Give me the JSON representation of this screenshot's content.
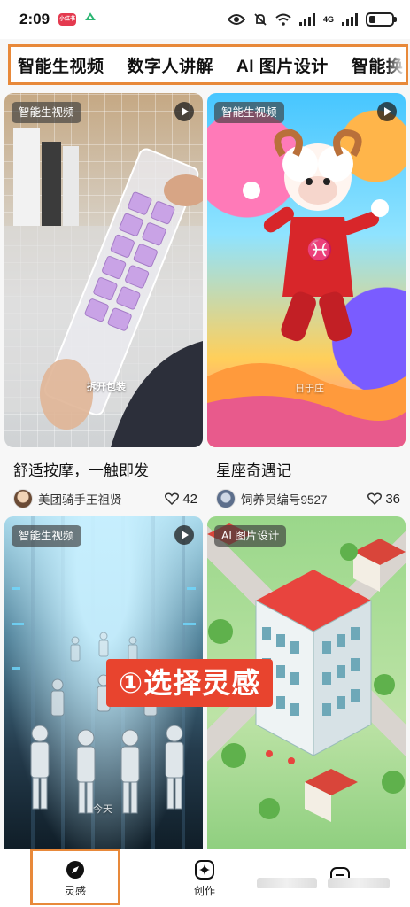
{
  "status_bar": {
    "time": "2:09",
    "app_badge": "小红书",
    "network": "4G"
  },
  "category_tabs": [
    {
      "label": "智能生视频"
    },
    {
      "label": "数字人讲解"
    },
    {
      "label": "AI 图片设计"
    },
    {
      "label": "智能换"
    }
  ],
  "cards": [
    {
      "badge": "智能生视频",
      "image_caption": "拆开包装",
      "title": "舒适按摩，一触即发",
      "author": "美团骑手王祖贤",
      "likes": "42",
      "has_play": true
    },
    {
      "badge": "智能生视频",
      "image_caption": "日于庄",
      "title": "星座奇遇记",
      "author": "饲养员编号9527",
      "likes": "36",
      "has_play": true
    },
    {
      "badge": "智能生视频",
      "image_caption": "今天",
      "has_play": true
    },
    {
      "badge": "AI 图片设计",
      "has_play": false
    }
  ],
  "overlay_banner": "①选择灵感",
  "bottom_nav": [
    {
      "label": "灵感",
      "icon": "compass-icon",
      "active": true
    },
    {
      "label": "创作",
      "icon": "sparkle-icon",
      "active": false
    },
    {
      "label": "",
      "icon": "menu-icon",
      "active": false
    }
  ],
  "colors": {
    "highlight": "#e8893a",
    "banner": "#e8442e"
  }
}
